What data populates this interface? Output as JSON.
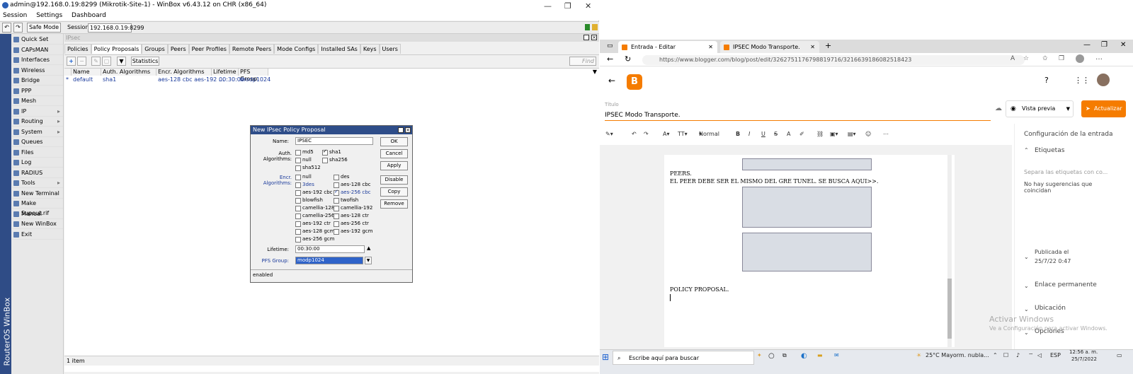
{
  "winbox": {
    "title": "admin@192.168.0.19:8299 (Mikrotik-Site-1) - WinBox v6.43.12 on CHR (x86_64)",
    "menu": [
      "Session",
      "Settings",
      "Dashboard"
    ],
    "safe_mode": "Safe Mode",
    "session_label": "Session:",
    "session_value": "192.168.0.19:8299",
    "vertical_brand": "RouterOS WinBox",
    "sidebar": [
      {
        "label": "Quick Set",
        "arrow": ""
      },
      {
        "label": "CAPsMAN",
        "arrow": ""
      },
      {
        "label": "Interfaces",
        "arrow": ""
      },
      {
        "label": "Wireless",
        "arrow": ""
      },
      {
        "label": "Bridge",
        "arrow": ""
      },
      {
        "label": "PPP",
        "arrow": ""
      },
      {
        "label": "Mesh",
        "arrow": ""
      },
      {
        "label": "IP",
        "arrow": "▸"
      },
      {
        "label": "Routing",
        "arrow": "▸"
      },
      {
        "label": "System",
        "arrow": "▸"
      },
      {
        "label": "Queues",
        "arrow": ""
      },
      {
        "label": "Files",
        "arrow": ""
      },
      {
        "label": "Log",
        "arrow": ""
      },
      {
        "label": "RADIUS",
        "arrow": ""
      },
      {
        "label": "Tools",
        "arrow": "▸"
      },
      {
        "label": "New Terminal",
        "arrow": ""
      },
      {
        "label": "Make Supout.rif",
        "arrow": ""
      },
      {
        "label": "Manual",
        "arrow": ""
      },
      {
        "label": "New WinBox",
        "arrow": ""
      },
      {
        "label": "Exit",
        "arrow": ""
      }
    ],
    "ipsec": {
      "title": "IPsec",
      "tabs": [
        "Policies",
        "Policy Proposals",
        "Groups",
        "Peers",
        "Peer Profiles",
        "Remote Peers",
        "Mode Configs",
        "Installed SAs",
        "Keys",
        "Users"
      ],
      "statistics": "Statistics",
      "find": "Find",
      "columns": [
        "Name",
        "Auth. Algorithms",
        "Encr. Algorithms",
        "Lifetime",
        "PFS Group"
      ],
      "row": {
        "star": "*",
        "name": "default",
        "auth": "sha1",
        "encr": "aes-128 cbc aes-192 ...",
        "lifetime": "00:30:00",
        "pfs": "modp1024"
      },
      "status": "1 item"
    },
    "dialog": {
      "title": "New IPsec Policy Proposal",
      "name_label": "Name:",
      "name_value": "IPSEC",
      "auth_label": "Auth. Algorithms:",
      "auth": [
        "md5",
        "sha1",
        "null",
        "sha256",
        "sha512"
      ],
      "encr_label": "Encr. Algorithms:",
      "encr_left": [
        "null",
        "3des",
        "aes-192 cbc",
        "blowfish",
        "camellia-128",
        "camellia-256",
        "aes-192 ctr",
        "aes-128 gcm",
        "aes-256 gcm"
      ],
      "encr_right": [
        "des",
        "aes-128 cbc",
        "aes-256 cbc",
        "twofish",
        "camellia-192",
        "aes-128 ctr",
        "aes-256 ctr",
        "aes-192 gcm"
      ],
      "lifetime_label": "Lifetime:",
      "lifetime_value": "00:30:00",
      "pfs_label": "PFS Group:",
      "pfs_value": "modp1024",
      "buttons": [
        "OK",
        "Cancel",
        "Apply",
        "Disable",
        "Copy",
        "Remove"
      ],
      "status": "enabled"
    }
  },
  "browser": {
    "tabs": [
      "Entrada - Editar",
      "IPSEC Modo Transporte."
    ],
    "url": "https://www.blogger.com/blog/post/edit/3262751176798819716/3216639186082518423",
    "titulo_label": "Título",
    "post_title": "IPSEC Modo Transporte.",
    "vista_previa": "Vista previa",
    "actualizar": "Actualizar",
    "format": "Normal",
    "doc_lines": [
      "PEERS.",
      "EL PEER DEBE SER EL MISMO DEL GRE TUNEL. SE BUSCA AQUI>>.",
      "POLICY PROPOSAL."
    ],
    "panel": {
      "config": "Configuración de la entrada",
      "etiquetas": "Etiquetas",
      "etiquetas_placeholder": "Separa las etiquetas con co...",
      "no_sugerencias": "No hay sugerencias que coincidan",
      "publicada": "Publicada el",
      "publicada_fecha": "25/7/22 0:47",
      "enlace": "Enlace permanente",
      "ubicacion": "Ubicación",
      "opciones": "Opciones"
    },
    "watermark": "Activar Windows",
    "watermark_sub": "Ve a Configuración para activar Windows."
  },
  "taskbar": {
    "search": "Escribe aquí para buscar",
    "weather": "25°C  Mayorm. nubla...",
    "lang": "ESP",
    "time": "12:56 a. m.",
    "date": "25/7/2022"
  }
}
